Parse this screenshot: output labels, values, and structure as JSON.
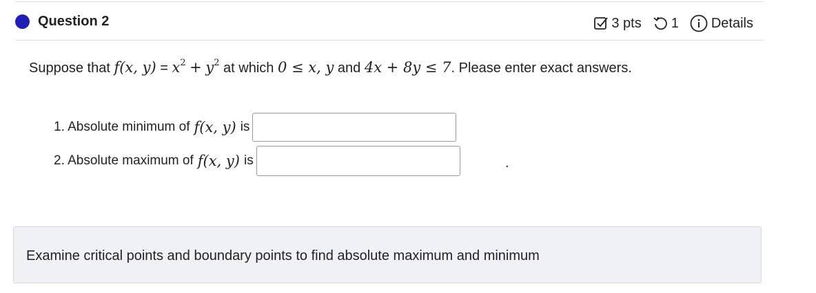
{
  "question": {
    "title": "Question 2",
    "points": "3 pts",
    "attempts": "1",
    "details_label": "Details"
  },
  "prompt": {
    "intro": "Suppose that",
    "func": "f(x, y)",
    "eq": "=",
    "x2": "x",
    "plus": "+",
    "y2": "y",
    "exp": "2",
    "at_which": "at which",
    "constraint1": "0 ≤ x, y",
    "and": "and",
    "constraint2": "4x + 8y ≤ 7",
    "outro": ". Please enter exact answers."
  },
  "items": [
    {
      "label": "1. Absolute minimum of",
      "func": "f(x, y)",
      "suffix": "is",
      "value": ""
    },
    {
      "label": "2. Absolute maximum of",
      "func": "f(x, y)",
      "suffix": "is",
      "value": ""
    }
  ],
  "trailing_period": ".",
  "hint": {
    "text": "Examine critical points and boundary points to find absolute maximum and minimum"
  }
}
